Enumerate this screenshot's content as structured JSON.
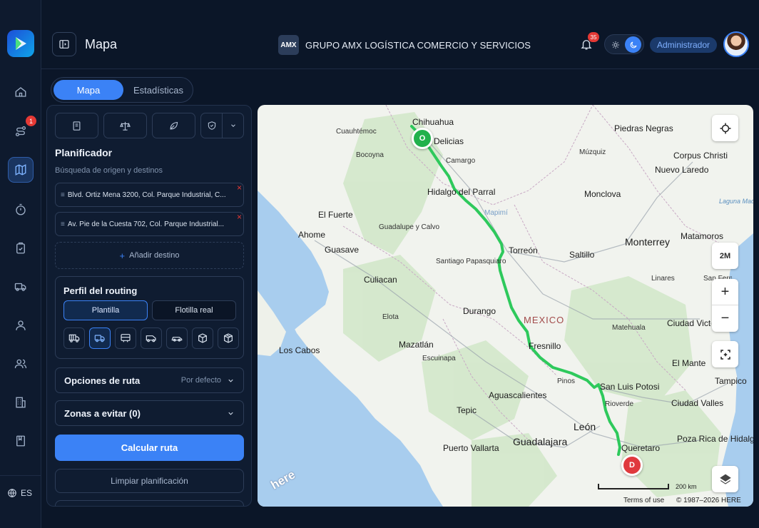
{
  "header": {
    "page_title": "Mapa",
    "brand_logo_text": "AMX",
    "brand_name": "GRUPO AMX LOGÍSTICA COMERCIO Y SERVICIOS",
    "notifications_count": "35",
    "role": "Administrador"
  },
  "sidebar": {
    "items": [
      {
        "name": "home",
        "icon": "home-icon"
      },
      {
        "name": "routes",
        "icon": "route-icon",
        "badge": "1"
      },
      {
        "name": "map",
        "icon": "map-icon",
        "active": true
      },
      {
        "name": "timer",
        "icon": "stopwatch-icon"
      },
      {
        "name": "tasks",
        "icon": "clipboard-check-icon"
      },
      {
        "name": "fleet",
        "icon": "truck-icon"
      },
      {
        "name": "user",
        "icon": "user-icon"
      },
      {
        "name": "users",
        "icon": "users-icon"
      },
      {
        "name": "buildings",
        "icon": "building-icon"
      },
      {
        "name": "book",
        "icon": "book-icon"
      }
    ],
    "language": "ES"
  },
  "tabs": [
    {
      "label": "Mapa",
      "active": true
    },
    {
      "label": "Estadísticas",
      "active": false
    }
  ],
  "planner": {
    "title": "Planificador",
    "subtitle": "Búsqueda de origen y destinos",
    "origin": "Blvd. Ortiz Mena 3200, Col. Parque Industrial, C...",
    "destination": "Av. Pie de la Cuesta 702, Col. Parque Industrial...",
    "add_destination": "Añadir destino",
    "routing_profile": {
      "title": "Perfil del routing",
      "option_template": "Plantilla",
      "option_fleet": "Flotilla real",
      "vehicles": [
        "truck-heavy-icon",
        "truck-icon",
        "bus-icon",
        "van-icon",
        "car-icon",
        "box-icon",
        "package-icon"
      ],
      "selected_vehicle_index": 1
    },
    "route_options": {
      "label": "Opciones de ruta",
      "value": "Por defecto"
    },
    "avoid_zones": {
      "label": "Zonas a evitar (0)"
    },
    "calculate_button": "Calcular ruta",
    "clear_button": "Limpiar planificación"
  },
  "map": {
    "country": "MEXICO",
    "cities": [
      "Chihuahua",
      "Cuauhtémoc",
      "Delicias",
      "Bocoyna",
      "Camargo",
      "Hidalgo del Parral",
      "Mapimí",
      "El Fuerte",
      "Ahome",
      "Guasave",
      "Guadalupe y Calvo",
      "Torreón",
      "Santiago Papasquiaro",
      "Culiacan",
      "Durango",
      "Elota",
      "Mazatlán",
      "Escuinapa",
      "Los Cabos",
      "Fresnillo",
      "Pinos",
      "San Luis Potosi",
      "Aguascalientes",
      "Rioverde",
      "Tepic",
      "León",
      "Guadalajara",
      "Puerto Vallarta",
      "Queretaro",
      "Piedras Negras",
      "Múzquiz",
      "Corpus Christi",
      "Nuevo Laredo",
      "Monclova",
      "Laguna Madre",
      "Matamoros",
      "Monterrey",
      "Saltillo",
      "Linares",
      "San Fernando",
      "Matehuala",
      "Ciudad Victoria",
      "El Mante",
      "Tampico",
      "Ciudad Valles",
      "Poza Rica de Hidalgo"
    ],
    "origin_marker": "O",
    "destination_marker": "D",
    "scale_label": "200 km",
    "scale_button": "2M",
    "terms": "Terms of use",
    "copyright": "© 1987–2026 HERE",
    "provider_logo": "here",
    "route_color": "#2ec95c"
  }
}
